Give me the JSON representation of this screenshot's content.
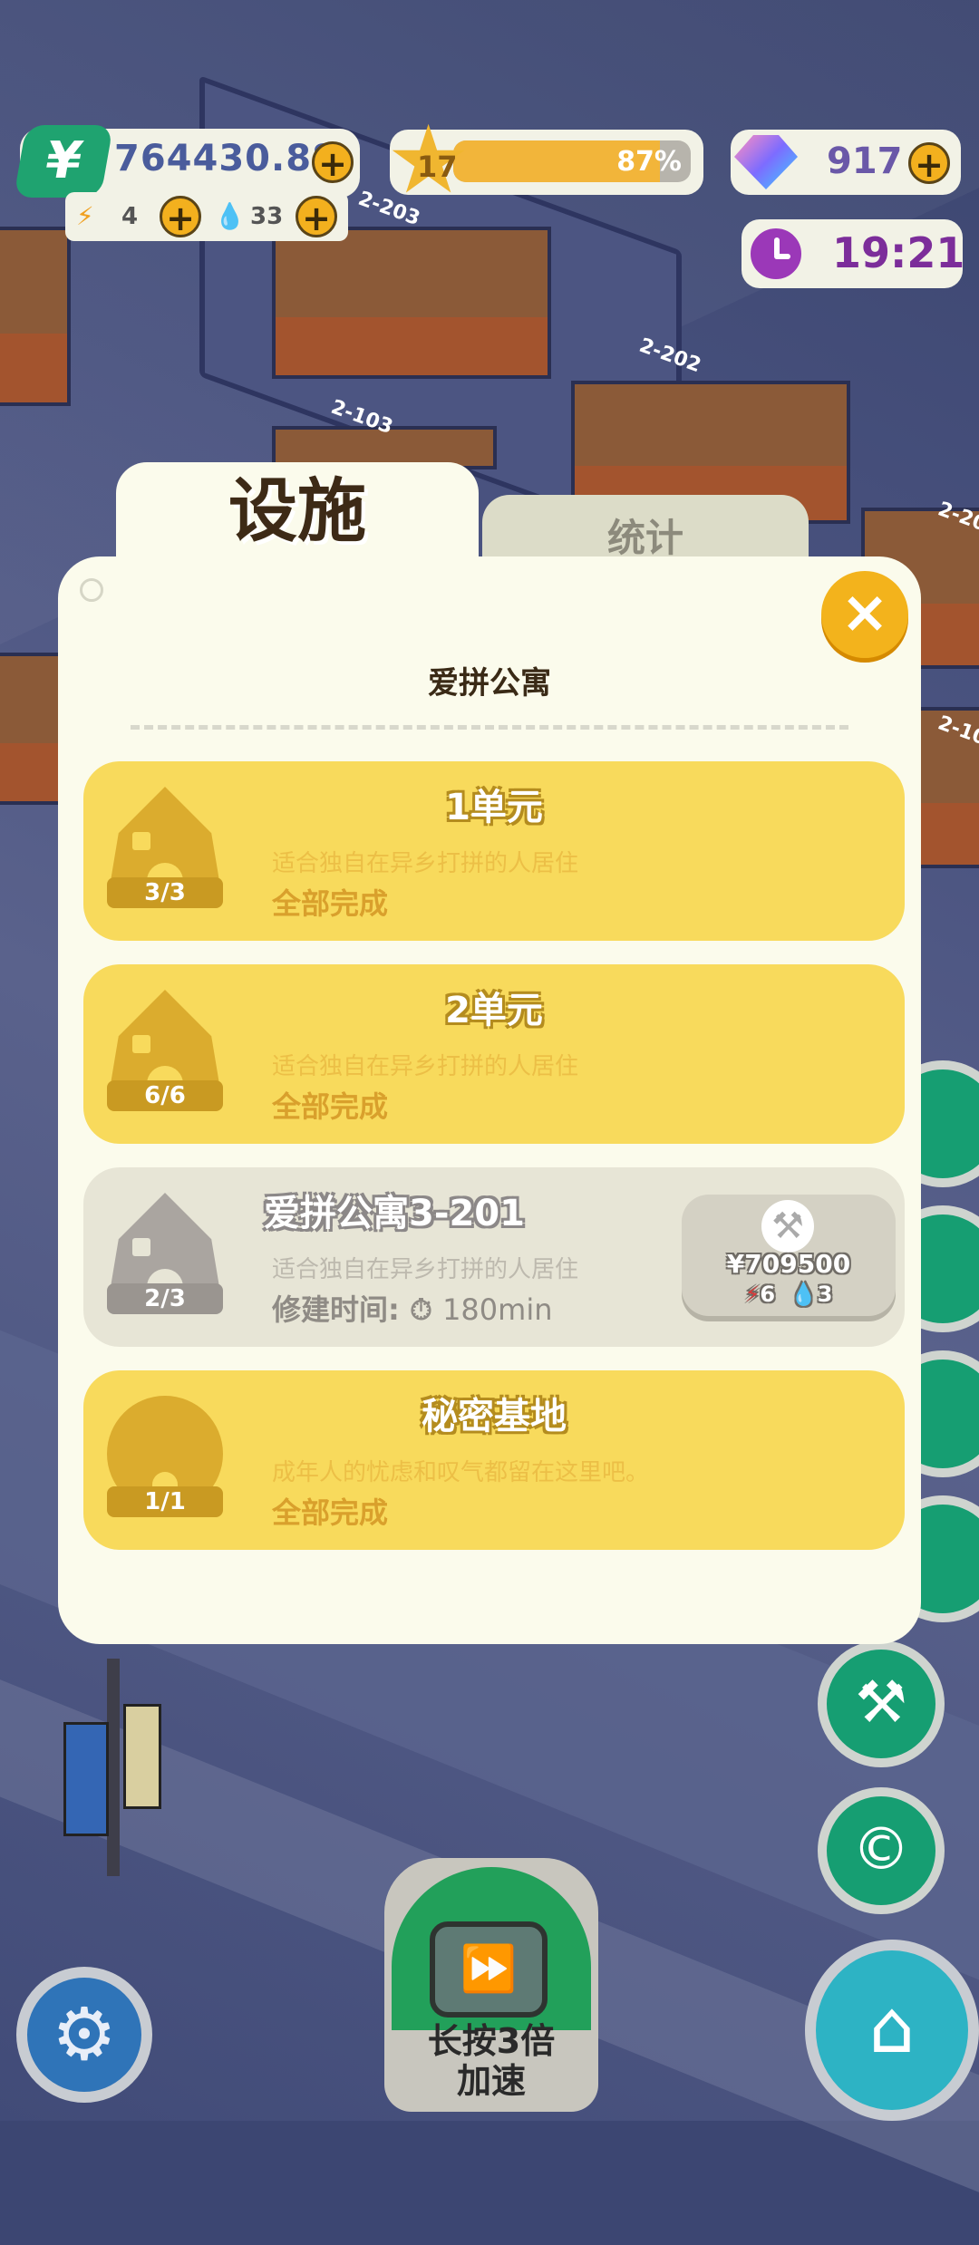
{
  "hud": {
    "money": "764430.88",
    "money_icon": "¥",
    "energy": "4",
    "water": "33",
    "level": "17",
    "level_percent": "87%",
    "level_progress": 0.87,
    "gems": "917",
    "time": "19:21",
    "plus": "+"
  },
  "background": {
    "room_labels": [
      "2-203",
      "2-202",
      "2-103",
      "2-20",
      "2-10"
    ]
  },
  "tabs": {
    "active": "设施",
    "inactive": "统计"
  },
  "panel": {
    "title": "爱拼公寓",
    "close_symbol": "×",
    "cards": [
      {
        "title": "1单元",
        "count": "3/3",
        "desc": "适合独自在异乡打拼的人居住",
        "status": "全部完成",
        "state": "done"
      },
      {
        "title": "2单元",
        "count": "6/6",
        "desc": "适合独自在异乡打拼的人居住",
        "status": "全部完成",
        "state": "done"
      },
      {
        "title": "爱拼公寓3-201",
        "count": "2/3",
        "desc": "适合独自在异乡打拼的人居住",
        "status": "修建时间:",
        "build_time": "180min",
        "state": "building",
        "cost": "709500",
        "cost_energy": "6",
        "cost_water": "3"
      },
      {
        "title": "秘密基地",
        "count": "1/1",
        "desc": "成年人的忧虑和叹气都留在这里吧。",
        "status": "全部完成",
        "state": "done"
      }
    ]
  },
  "bottom": {
    "speed_label_line1": "长按3倍",
    "speed_label_line2": "加速"
  },
  "colors": {
    "card_yellow": "#f8da5c",
    "card_grey": "#e7e5d6",
    "panel_bg": "#fbfbec",
    "accent_orange": "#f3b31c",
    "green_button": "#169e72"
  },
  "icons": [
    "money-icon",
    "energy-icon",
    "water-icon",
    "star-icon",
    "gem-icon",
    "clock-icon",
    "close-icon",
    "house-icon",
    "hammer-icon",
    "timer-icon",
    "tools-icon",
    "coin-icon",
    "settings-icon",
    "tv-speed-icon",
    "home-icon"
  ]
}
